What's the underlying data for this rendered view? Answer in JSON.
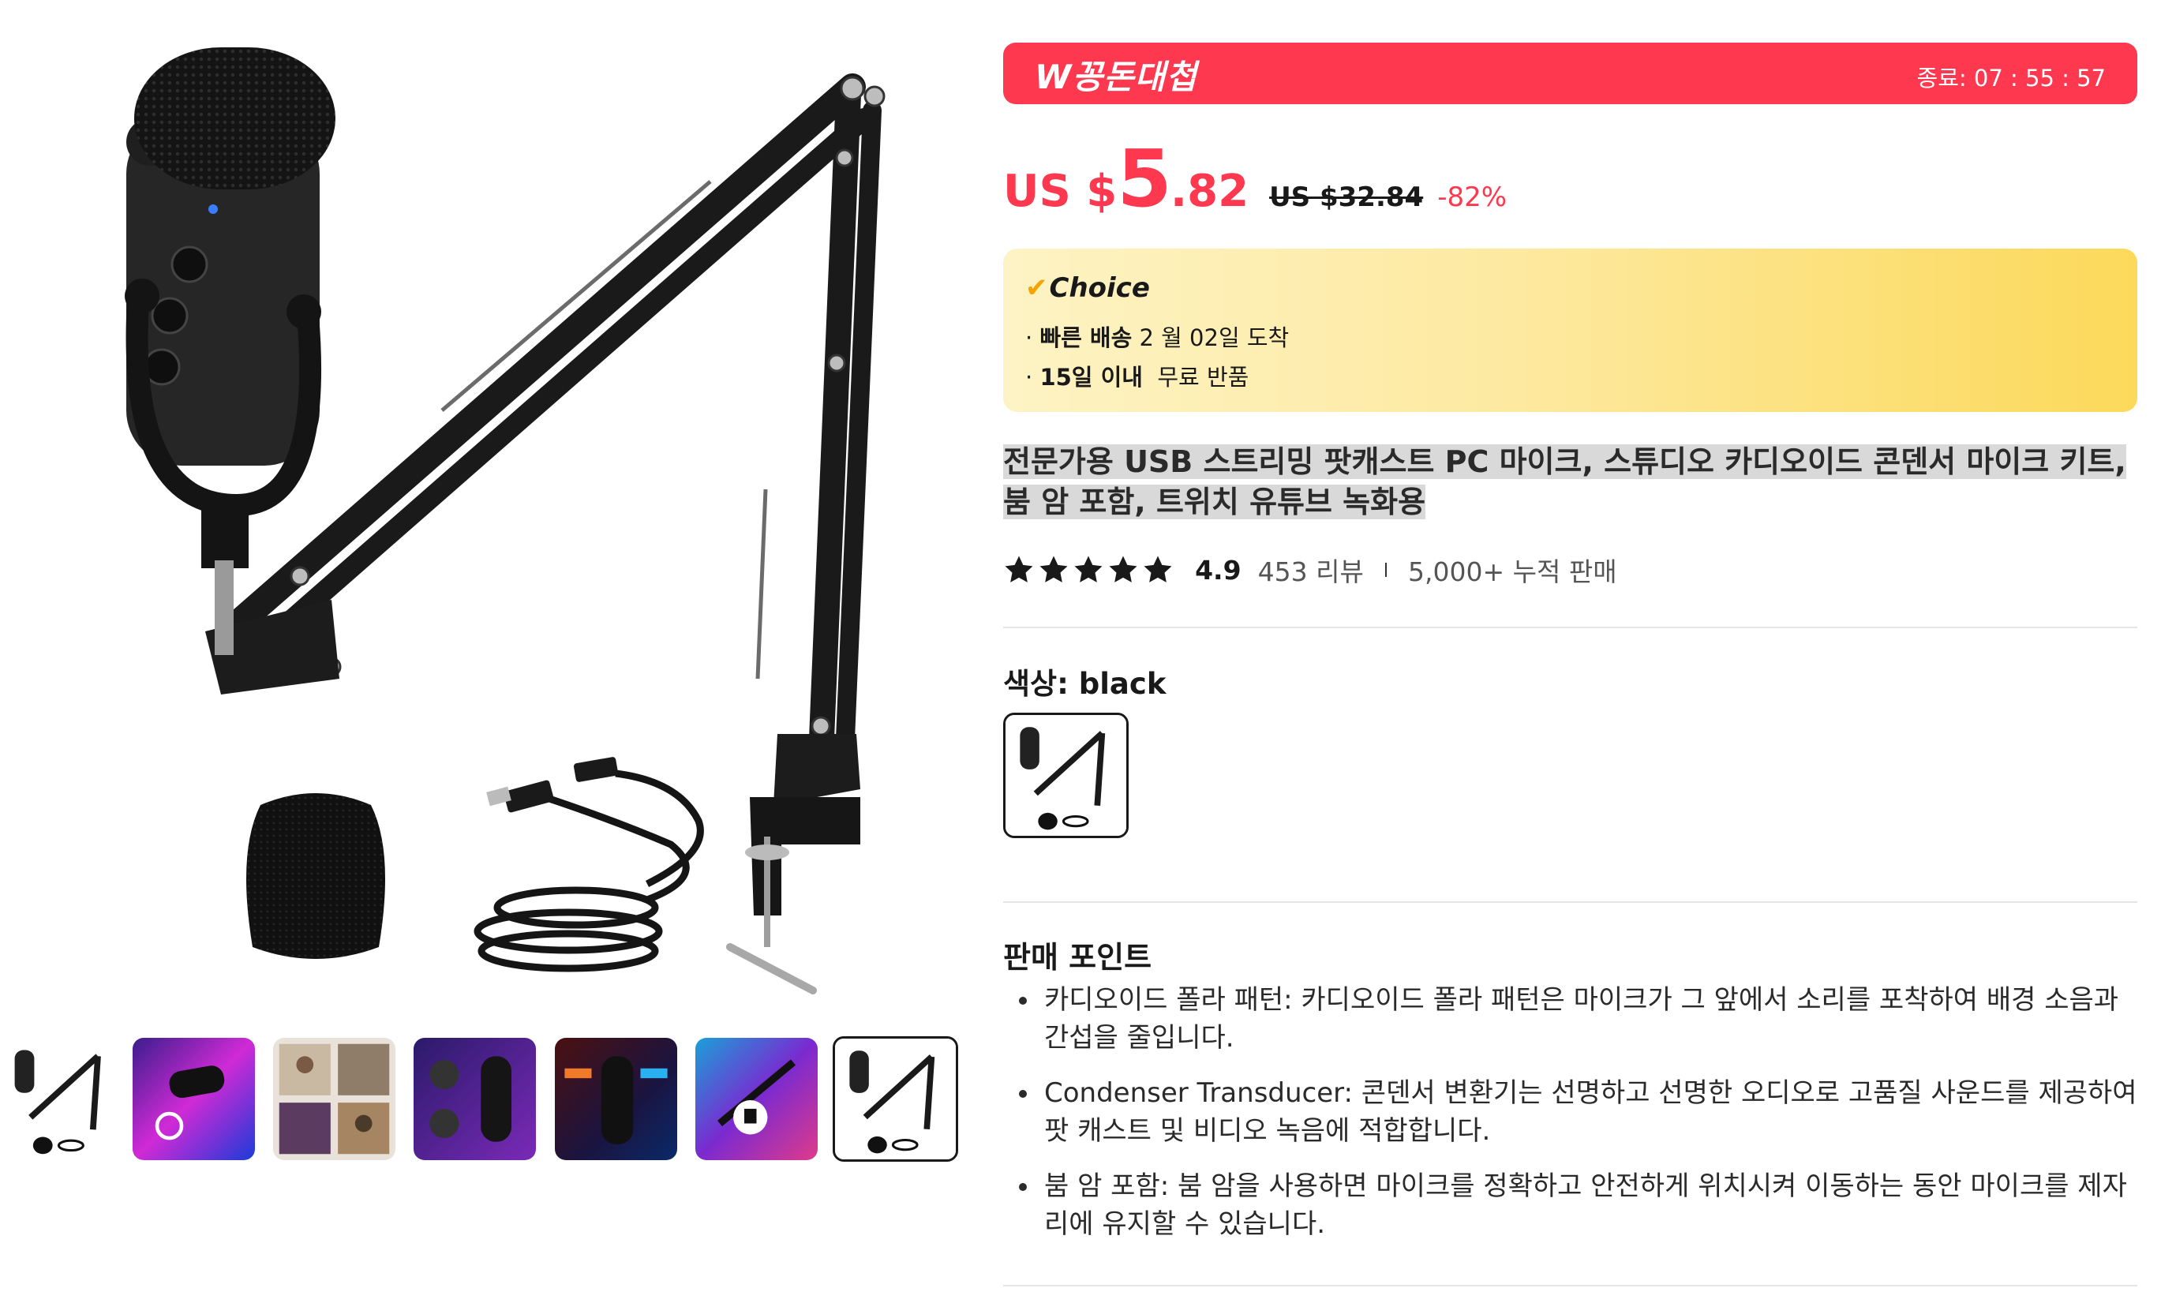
{
  "gallery": {
    "main_image_alt": "Microphone with boom arm, pop filter and USB cable",
    "thumbnails": [
      {
        "name": "thumb-1"
      },
      {
        "name": "thumb-2"
      },
      {
        "name": "thumb-3"
      },
      {
        "name": "thumb-4"
      },
      {
        "name": "thumb-5"
      },
      {
        "name": "thumb-6"
      },
      {
        "name": "thumb-7",
        "selected": true
      }
    ]
  },
  "promo": {
    "title": "W꽁돈대첩",
    "timer": "종료: 07 : 55 : 57",
    "color": "#fd384f"
  },
  "price": {
    "currency": "US $",
    "integer": "5",
    "decimal": ".82",
    "original": "US $32.84",
    "discount": "-82%"
  },
  "choice": {
    "logo": "Choice",
    "fast_delivery_label": "빠른 배송",
    "fast_delivery_value": "2 월 02일 도착",
    "return_label": "15일 이내",
    "return_value": "무료 반품"
  },
  "product": {
    "title": "전문가용 USB 스트리밍 팟캐스트 PC 마이크, 스튜디오 카디오이드 콘덴서 마이크 키트, 붐 암 포함, 트위치 유튜브 녹화용",
    "rating": "4.9",
    "stars": 5,
    "reviews": "453 리뷰",
    "sold": "5,000+ 누적 판매"
  },
  "color": {
    "label": "색상: black"
  },
  "selling_points": {
    "heading": "판매 포인트",
    "items": [
      "카디오이드 폴라 패턴: 카디오이드 폴라 패턴은 마이크가 그 앞에서 소리를 포착하여 배경 소음과 간섭을 줄입니다.",
      "Condenser Transducer: 콘덴서 변환기는 선명하고 선명한 오디오로 고품질 사운드를 제공하여 팟 캐스트 및 비디오 녹음에 적합합니다.",
      "붐 암 포함: 붐 암을 사용하면 마이크를 정확하고 안전하게 위치시켜 이동하는 동안 마이크를 제자리에 유지할 수 있습니다."
    ]
  }
}
